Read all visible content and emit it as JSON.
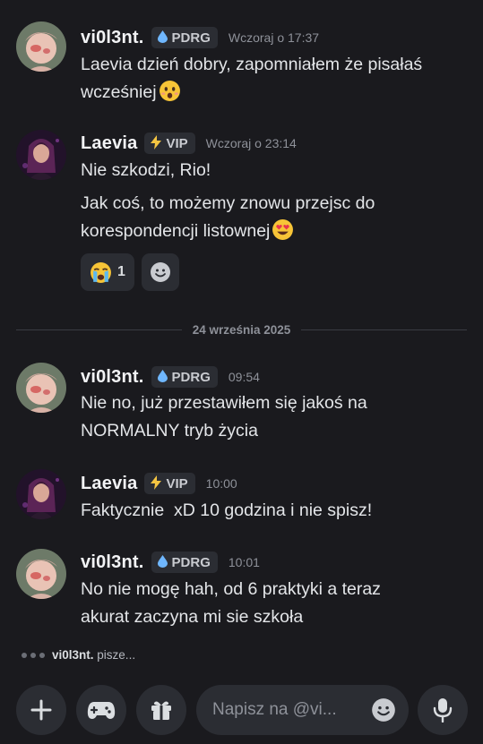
{
  "messages": [
    {
      "author": "vi0l3nt.",
      "tag": {
        "icon": "water-drop-icon",
        "label": "PDRG"
      },
      "time": "Wczoraj o 17:37",
      "lines": [
        "Laevia dzień dobry, zapomniałem że pisałaś",
        "wcześniej"
      ],
      "emoji": "astonished-face-emoji"
    },
    {
      "author": "Laevia",
      "tag": {
        "icon": "lightning-bolt-icon",
        "label": "VIP"
      },
      "time": "Wczoraj o 23:14",
      "lines": [
        "Nie szkodzi, Rio!",
        "Jak coś, to możemy znowu przejsc do",
        "korespondencji listownej"
      ],
      "emoji": "heart-eyes-emoji",
      "reactions": [
        {
          "emoji": "loudly-crying-face-emoji",
          "count": "1"
        }
      ]
    },
    {
      "author": "vi0l3nt.",
      "tag": {
        "icon": "water-drop-icon",
        "label": "PDRG"
      },
      "time": "09:54",
      "lines": [
        "Nie no, już przestawiłem się jakoś na",
        "NORMALNY tryb życia"
      ]
    },
    {
      "author": "Laevia",
      "tag": {
        "icon": "lightning-bolt-icon",
        "label": "VIP"
      },
      "time": "10:00",
      "lines": [
        "Faktycznie  xD 10 godzina i nie spisz!"
      ]
    },
    {
      "author": "vi0l3nt.",
      "tag": {
        "icon": "water-drop-icon",
        "label": "PDRG"
      },
      "time": "10:01",
      "lines": [
        "No nie mogę hah, od 6 praktyki a teraz",
        "akurat zaczyna mi sie szkoła"
      ]
    }
  ],
  "divider": {
    "date": "24 września 2025"
  },
  "typing": {
    "user": "vi0l3nt.",
    "text": "pisze..."
  },
  "composer": {
    "placeholder": "Napisz na @vi...",
    "buttons": [
      "plus-icon",
      "gamepad-icon",
      "gift-icon",
      "microphone-icon"
    ]
  },
  "colors": {
    "background": "#1a1a1e",
    "surface": "#2b2d33",
    "text": "#e3e5e8",
    "muted": "#8e9199",
    "pdrg_icon": "#6fb7ff",
    "vip_icon": "#f5c542"
  }
}
